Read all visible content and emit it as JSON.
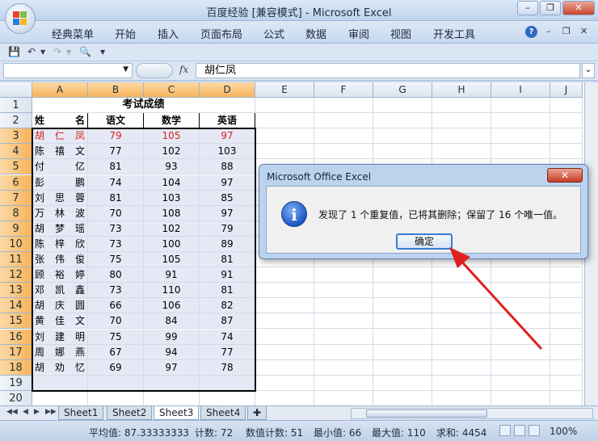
{
  "window": {
    "title": "百度经验 [兼容模式] - Microsoft Excel",
    "minimize": "–",
    "restore": "❐",
    "close": "✕"
  },
  "ribbon": {
    "tabs": [
      "经典菜单",
      "开始",
      "插入",
      "页面布局",
      "公式",
      "数据",
      "审阅",
      "视图",
      "开发工具"
    ],
    "help": "?",
    "min": "–",
    "restore": "❐",
    "close": "✕"
  },
  "formula_bar": {
    "name_box": "",
    "fx": "fx",
    "value": "胡仁凤"
  },
  "columns": [
    "A",
    "B",
    "C",
    "D",
    "E",
    "F",
    "G",
    "H",
    "I",
    "J"
  ],
  "rows": [
    "1",
    "2",
    "3",
    "4",
    "5",
    "6",
    "7",
    "8",
    "9",
    "10",
    "11",
    "12",
    "13",
    "14",
    "15",
    "16",
    "17",
    "18",
    "19",
    "20"
  ],
  "sheet": {
    "title": "考试成绩",
    "headers": [
      "姓名",
      "语文",
      "数学",
      "英语"
    ],
    "data": [
      [
        "胡仁凤",
        "79",
        "105",
        "97"
      ],
      [
        "陈禧文",
        "77",
        "102",
        "103"
      ],
      [
        "付亿",
        "81",
        "93",
        "88"
      ],
      [
        "彭鹏",
        "74",
        "104",
        "97"
      ],
      [
        "刘思蓉",
        "81",
        "103",
        "85"
      ],
      [
        "万林波",
        "70",
        "108",
        "97"
      ],
      [
        "胡梦瑶",
        "73",
        "102",
        "79"
      ],
      [
        "陈梓欣",
        "73",
        "100",
        "89"
      ],
      [
        "张伟俊",
        "75",
        "105",
        "81"
      ],
      [
        "顾裕婷",
        "80",
        "91",
        "91"
      ],
      [
        "邓凯鑫",
        "73",
        "110",
        "81"
      ],
      [
        "胡庆圆",
        "66",
        "106",
        "82"
      ],
      [
        "黄佳文",
        "70",
        "84",
        "87"
      ],
      [
        "刘建明",
        "75",
        "99",
        "74"
      ],
      [
        "周娜燕",
        "67",
        "94",
        "77"
      ],
      [
        "胡劝忆",
        "69",
        "97",
        "78"
      ]
    ]
  },
  "dialog": {
    "title": "Microsoft Office Excel",
    "close": "✕",
    "message": "发现了 1 个重复值，已将其删除；保留了 16 个唯一值。",
    "ok": "确定",
    "icon": "i"
  },
  "sheet_tabs": [
    "Sheet1",
    "Sheet2",
    "Sheet3",
    "Sheet4"
  ],
  "active_sheet": "Sheet3",
  "status": {
    "average": "平均值: 87.33333333",
    "count": "计数: 72",
    "numeric_count": "数值计数: 51",
    "min": "最小值: 66",
    "max": "最大值: 110",
    "sum": "求和: 4454",
    "zoom": "100%"
  },
  "colors": {
    "selection_header": "#f7b35b",
    "duplicate_text": "#d42222",
    "arrow": "#e02020"
  }
}
